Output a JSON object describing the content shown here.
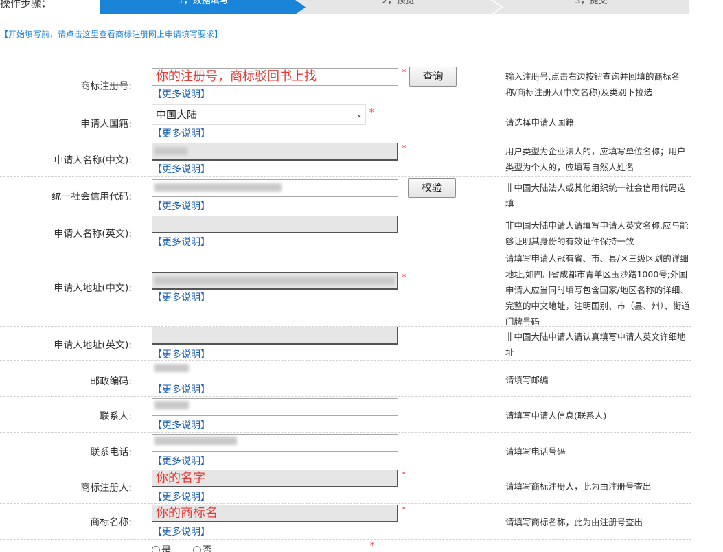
{
  "steps": {
    "label": "操作步骤：",
    "items": [
      "1，数据填写",
      "2，预览",
      "3，提交"
    ]
  },
  "notice": "【开始填写前，请点击这里查看商标注册网上申请填写要求】",
  "more_label": "【更多说明】",
  "colors": {
    "accent": "#1a84d8",
    "required": "#e53935",
    "link": "#1a5fb4"
  },
  "rows": [
    {
      "label": "商标注册号:",
      "value": "你的注册号，商标驳回书上找",
      "button": "查询",
      "hint": "输入注册号,点击右边按钮查询并回填的商标名称/商标注册人(中文名称)及类别下拉选"
    },
    {
      "label": "申请人国籍:",
      "value": "中国大陆",
      "hint": "请选择申请人国籍"
    },
    {
      "label": "申请人名称(中文):",
      "value": "",
      "hint": "用户类型为企业法人的，应填写单位名称；用户类型为个人的，应填写自然人姓名"
    },
    {
      "label": "统一社会信用代码:",
      "value": "",
      "button": "校验",
      "hint": "非中国大陆法人或其他组织统一社会信用代码选填"
    },
    {
      "label": "申请人名称(英文):",
      "value": "",
      "hint": "非中国大陆申请人请填写申请人英文名称,应与能够证明其身份的有效证件保持一致"
    },
    {
      "label": "申请人地址(中文):",
      "value": "",
      "hint": "请填写申请人冠有省、市、县/区三级区划的详细地址,如四川省成都市青羊区玉沙路1000号;外国申请人应当同时填写包含国家/地区名称的详细、完整的中文地址，注明国别、市（县、州）、街道门牌号码"
    },
    {
      "label": "申请人地址(英文):",
      "value": "",
      "hint": "非中国大陆申请人请认真填写申请人英文详细地址"
    },
    {
      "label": "邮政编码:",
      "value": "",
      "hint": "请填写邮编"
    },
    {
      "label": "联系人:",
      "value": "",
      "hint": "请填写申请人信息(联系人)"
    },
    {
      "label": "联系电话:",
      "value": "",
      "hint": "请填写电话号码"
    },
    {
      "label": "商标注册人:",
      "value": "你的名字",
      "hint": "请填写商标注册人，此为由注册号查出"
    },
    {
      "label": "商标名称:",
      "value": "你的商标名",
      "hint": "请填写商标名称，此为由注册号查出"
    }
  ],
  "radio": {
    "options": [
      "是",
      "否"
    ]
  }
}
